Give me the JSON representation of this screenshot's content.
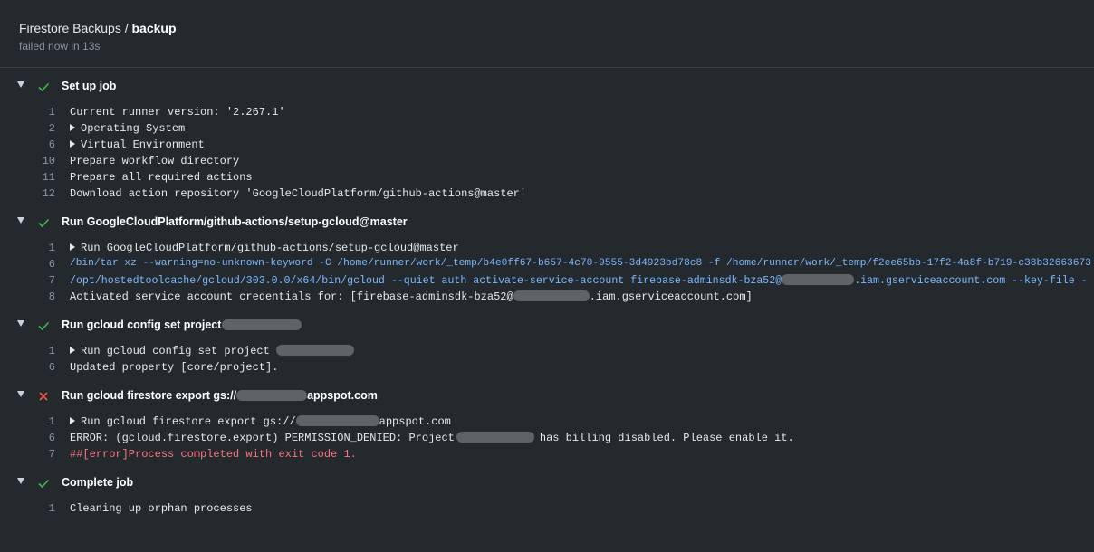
{
  "header": {
    "workflow": "Firestore Backups",
    "separator": "/",
    "job": "backup",
    "status": "failed now in 13s"
  },
  "steps": [
    {
      "label": "Set up job",
      "status": "success",
      "lines": [
        {
          "n": "1",
          "text": "Current runner version: '2.267.1'"
        },
        {
          "n": "2",
          "text": "Operating System"
        },
        {
          "n": "6",
          "text": "Virtual Environment"
        },
        {
          "n": "10",
          "text": "Prepare workflow directory"
        },
        {
          "n": "11",
          "text": "Prepare all required actions"
        },
        {
          "n": "12",
          "text": "Download action repository 'GoogleCloudPlatform/github-actions@master'"
        }
      ]
    },
    {
      "label": "Run GoogleCloudPlatform/github-actions/setup-gcloud@master",
      "status": "success",
      "lines": [
        {
          "n": "1",
          "text": "Run GoogleCloudPlatform/github-actions/setup-gcloud@master"
        },
        {
          "n": "6",
          "text": "/bin/tar xz --warning=no-unknown-keyword -C /home/runner/work/_temp/b4e0ff67-b657-4c70-9555-3d4923bd78c8 -f /home/runner/work/_temp/f2ee65bb-17f2-4a8f-b719-c38b32663673"
        },
        {
          "n": "7",
          "text_a": "/opt/hostedtoolcache/gcloud/303.0.0/x64/bin/gcloud --quiet auth activate-service-account firebase-adminsdk-bza52@",
          "text_b": ".iam.gserviceaccount.com --key-file -"
        },
        {
          "n": "8",
          "text_a": "Activated service account credentials for: [firebase-adminsdk-bza52@",
          "text_b": ".iam.gserviceaccount.com]"
        }
      ]
    },
    {
      "label": "Run gcloud config set project",
      "status": "success",
      "lines": [
        {
          "n": "1",
          "text": "Run gcloud config set project"
        },
        {
          "n": "6",
          "text": "Updated property [core/project]."
        }
      ]
    },
    {
      "label_a": "Run gcloud firestore export gs://",
      "label_b": "appspot.com",
      "status": "failure",
      "lines": [
        {
          "n": "1",
          "text_a": "Run gcloud firestore export gs://",
          "text_b": "appspot.com"
        },
        {
          "n": "6",
          "text_a": "ERROR: (gcloud.firestore.export) PERMISSION_DENIED: Project",
          "text_b": "has billing disabled. Please enable it."
        },
        {
          "n": "7",
          "text": "##[error]Process completed with exit code 1."
        }
      ]
    },
    {
      "label": "Complete job",
      "status": "success",
      "lines": [
        {
          "n": "1",
          "text": "Cleaning up orphan processes"
        }
      ]
    }
  ],
  "colors": {
    "success": "#3fb950",
    "failure": "#f85149",
    "command": "#79b8ff",
    "error_text": "#f97583"
  },
  "icons": [
    "caret-down-icon",
    "check-icon",
    "x-icon",
    "caret-right-icon"
  ]
}
